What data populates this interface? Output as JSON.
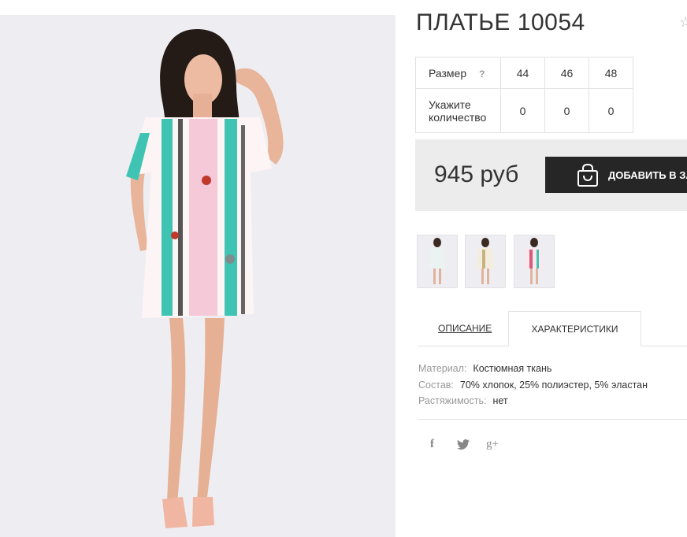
{
  "product": {
    "title": "ПЛАТЬЕ 10054",
    "favorite_icon": "star-icon"
  },
  "sizes": {
    "row_label": "Размер",
    "help": "?",
    "values": [
      "44",
      "46",
      "48"
    ],
    "qty_label_1": "Укажите",
    "qty_label_2": "количество",
    "qty": [
      "0",
      "0",
      "0"
    ]
  },
  "price": "945 руб",
  "cart": {
    "label": "ДОБАВИТЬ В ЗАКАЗ",
    "icon": "shopping-bag-icon"
  },
  "tabs": {
    "description": "ОПИСАНИЕ",
    "characteristics": "ХАРАКТЕРИСТИКИ"
  },
  "props": [
    {
      "k": "Материал:",
      "v": "Костюмная ткань"
    },
    {
      "k": "Состав:",
      "v": "70% хлопок, 25% полиэстер, 5% эластан"
    },
    {
      "k": "Растяжимость:",
      "v": "нет"
    }
  ],
  "social": {
    "facebook": "f",
    "twitter": "twitter-bird-icon",
    "googleplus": "g+"
  },
  "colors": {
    "dark_button": "#262626",
    "price_bg": "#ececec",
    "photo_bg": "#eeeef2",
    "dress_teal": "#3fc4b4",
    "dress_pink": "#f6c9d8"
  }
}
